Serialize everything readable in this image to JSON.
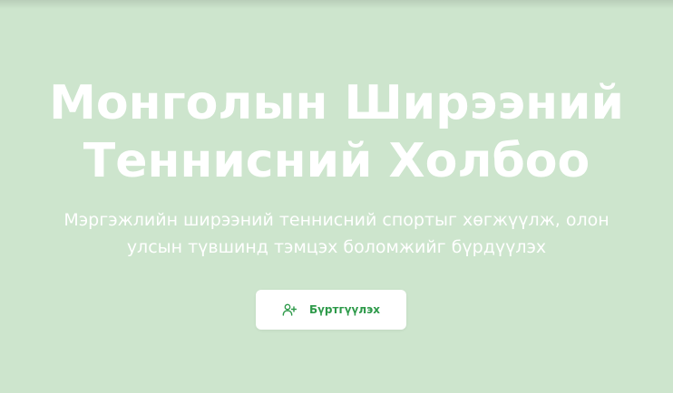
{
  "hero": {
    "title_line1": "Монголын Ширээний",
    "title_line2": "Теннисний Холбоо",
    "subtitle_line1": "Мэргэжлийн ширээний теннисний спортыг хөгжүүлж, олон",
    "subtitle_line2": "улсын түвшинд тэмцэх боломжийг бүрдүүлэх"
  },
  "cta": {
    "label": "Бүртгүүлэх",
    "icon": "user-plus-icon"
  },
  "colors": {
    "background": "#cde5cd",
    "title_text": "#ffffff",
    "button_bg": "#ffffff",
    "button_text": "#2e9a4a"
  }
}
